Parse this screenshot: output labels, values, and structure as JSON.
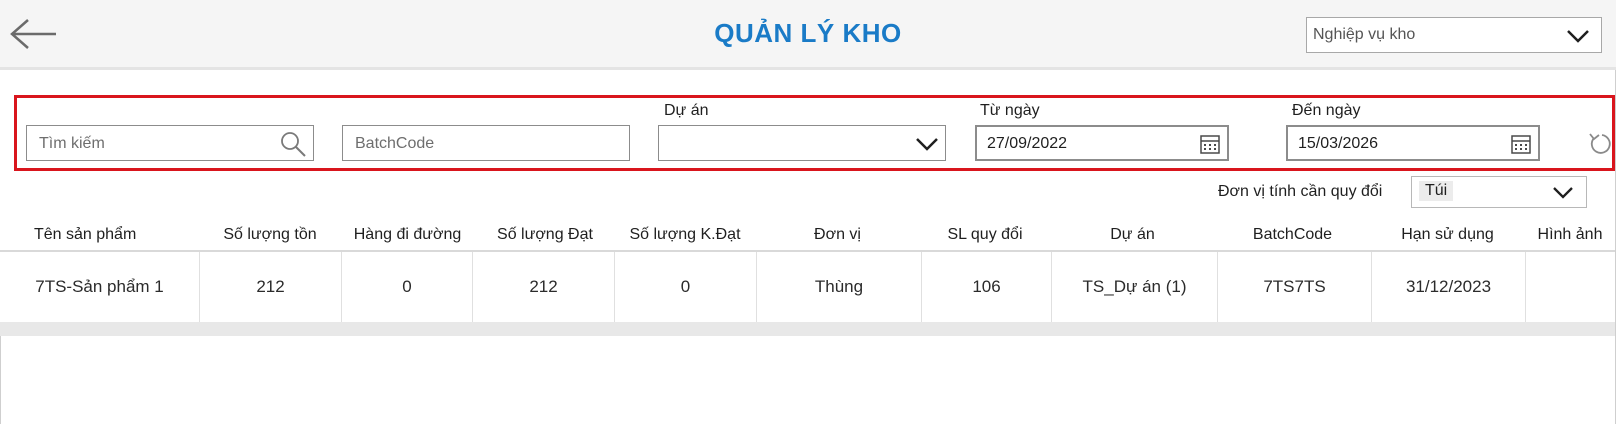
{
  "header": {
    "title": "QUẢN LÝ KHO",
    "back_icon": "arrow-left-icon",
    "nav_select": {
      "placeholder": "Nghiệp vụ kho"
    }
  },
  "filters": {
    "search": {
      "placeholder": "Tìm kiếm",
      "icon": "search-icon"
    },
    "batchcode": {
      "placeholder": "BatchCode"
    },
    "project": {
      "label": "Dự án",
      "value": ""
    },
    "from_date": {
      "label": "Từ ngày",
      "value": "27/09/2022",
      "icon": "calendar-icon"
    },
    "to_date": {
      "label": "Đến ngày",
      "value": "15/03/2026",
      "icon": "calendar-icon"
    },
    "reset_icon": "refresh-icon"
  },
  "unit_conversion": {
    "label": "Đơn vị tính cần quy đổi",
    "value": "Túi"
  },
  "table": {
    "columns": [
      "Tên sản phẩm",
      "Số lượng tồn",
      "Hàng đi đường",
      "Số lượng Đạt",
      "Số lượng K.Đạt",
      "Đơn vị",
      "SL quy đổi",
      "Dự án",
      "BatchCode",
      "Hạn sử dụng",
      "Hình ảnh"
    ],
    "rows": [
      [
        "7TS-Sản phẩm 1",
        "212",
        "0",
        "212",
        "0",
        "Thùng",
        "106",
        "TS_Dự án (1)",
        "7TS7TS",
        "31/12/2023",
        ""
      ]
    ]
  },
  "colors": {
    "title": "#1a7bc7",
    "highlight_border": "#d9151d"
  }
}
